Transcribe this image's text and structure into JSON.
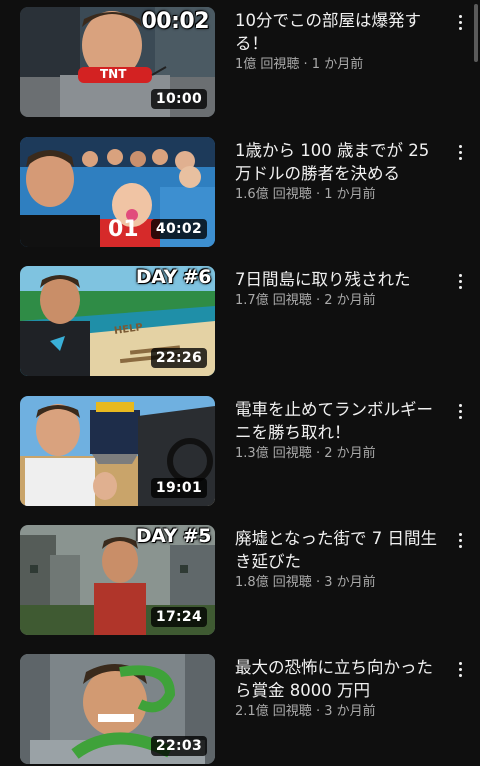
{
  "videos": [
    {
      "title": "10分でこの部屋は爆発する！",
      "stats": "1億 回視聴 · 1 か月前",
      "duration": "10:00",
      "thumb_text": "00:02",
      "thumb_sub": "TNT"
    },
    {
      "title": "1歳から 100 歳までが 25 万ドルの勝者を決める",
      "stats": "1.6億 回視聴 · 1 か月前",
      "duration": "40:02",
      "thumb_sub": "01"
    },
    {
      "title": "7日間島に取り残された",
      "stats": "1.7億 回視聴 · 2 か月前",
      "duration": "22:26",
      "thumb_text": "DAY #6",
      "thumb_sub": "HELP"
    },
    {
      "title": "電車を止めてランボルギーニを勝ち取れ！",
      "stats": "1.3億 回視聴 · 2 か月前",
      "duration": "19:01"
    },
    {
      "title": "廃墟となった街で 7 日間生き延びた",
      "stats": "1.8億 回視聴 · 3 か月前",
      "duration": "17:24",
      "thumb_text": "DAY #5"
    },
    {
      "title": "最大の恐怖に立ち向かったら賞金 8000 万円",
      "stats": "2.1億 回視聴 · 3 か月前",
      "duration": "22:03"
    }
  ],
  "colors": {
    "background": "#0f0f0f",
    "title": "#f1f1f1",
    "meta": "#aaaaaa"
  },
  "icons": {
    "menu": "more-vert-icon"
  }
}
